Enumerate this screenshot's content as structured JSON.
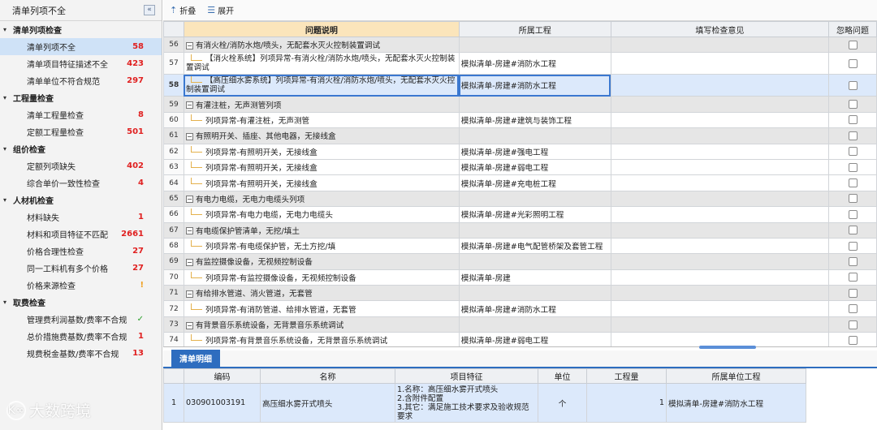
{
  "sidebar": {
    "title": "清单列项不全",
    "collapse_icon": "«",
    "groups": [
      {
        "label": "清单列项检查",
        "items": [
          {
            "label": "清单列项不全",
            "count": "58",
            "status": "error"
          },
          {
            "label": "清单项目特征描述不全",
            "count": "423",
            "status": "error"
          },
          {
            "label": "清单单位不符合规范",
            "count": "297",
            "status": "error"
          }
        ]
      },
      {
        "label": "工程量检查",
        "items": [
          {
            "label": "清单工程量检查",
            "count": "8",
            "status": "error"
          },
          {
            "label": "定额工程量检查",
            "count": "501",
            "status": "error"
          }
        ]
      },
      {
        "label": "组价检查",
        "items": [
          {
            "label": "定额列项缺失",
            "count": "402",
            "status": "error"
          },
          {
            "label": "综合单价一致性检查",
            "count": "4",
            "status": "error"
          }
        ]
      },
      {
        "label": "人材机检查",
        "items": [
          {
            "label": "材料缺失",
            "count": "1",
            "status": "error"
          },
          {
            "label": "材料和项目特征不匹配",
            "count": "2661",
            "status": "error"
          },
          {
            "label": "价格合理性检查",
            "count": "27",
            "status": "error"
          },
          {
            "label": "同一工料机有多个价格",
            "count": "27",
            "status": "error"
          },
          {
            "label": "价格来源检查",
            "count": "!",
            "status": "warn"
          }
        ]
      },
      {
        "label": "取费检查",
        "items": [
          {
            "label": "管理费利润基数/费率不合规",
            "count": "✓",
            "status": "ok"
          },
          {
            "label": "总价措施费基数/费率不合规",
            "count": "1",
            "status": "error"
          },
          {
            "label": "规费税金基数/费率不合规",
            "count": "13",
            "status": "error"
          }
        ]
      }
    ]
  },
  "watermark": {
    "logo": "K∞",
    "text": "大数跨境"
  },
  "toolbar": {
    "collapse_label": "折叠",
    "expand_label": "展开"
  },
  "grid": {
    "headers": [
      "问题说明",
      "所属工程",
      "填写检查意见",
      "忽略问题"
    ],
    "rows": [
      {
        "num": "56",
        "type": "group",
        "desc": "有消火栓/消防水炮/喷头，无配套水灭火控制装置调试",
        "proj": ""
      },
      {
        "num": "57",
        "type": "child",
        "tall": true,
        "desc": "【消火栓系统】列项异常-有消火栓/消防水炮/喷头，无配套水灭火控制装置调试",
        "proj": "模拟清单-房建#消防水工程"
      },
      {
        "num": "58",
        "type": "child",
        "tall": true,
        "selected": true,
        "desc": "【高压细水雾系统】列项异常-有消火栓/消防水炮/喷头，无配套水灭火控制装置调试",
        "proj": "模拟清单-房建#消防水工程"
      },
      {
        "num": "59",
        "type": "group",
        "desc": "有灌注桩，无声测管列项",
        "proj": ""
      },
      {
        "num": "60",
        "type": "child",
        "desc": "列项异常-有灌注桩，无声测管",
        "proj": "模拟清单-房建#建筑与装饰工程"
      },
      {
        "num": "61",
        "type": "group",
        "desc": "有照明开关、插座、其他电器，无接线盒",
        "proj": ""
      },
      {
        "num": "62",
        "type": "child",
        "desc": "列项异常-有照明开关，无接线盒",
        "proj": "模拟清单-房建#强电工程"
      },
      {
        "num": "63",
        "type": "child",
        "desc": "列项异常-有照明开关，无接线盒",
        "proj": "模拟清单-房建#弱电工程"
      },
      {
        "num": "64",
        "type": "child",
        "desc": "列项异常-有照明开关，无接线盒",
        "proj": "模拟清单-房建#充电桩工程"
      },
      {
        "num": "65",
        "type": "group",
        "desc": "有电力电缆，无电力电缆头列项",
        "proj": ""
      },
      {
        "num": "66",
        "type": "child",
        "desc": "列项异常-有电力电缆，无电力电缆头",
        "proj": "模拟清单-房建#光彩照明工程"
      },
      {
        "num": "67",
        "type": "group",
        "desc": "有电缆保护管清单，无挖/填土",
        "proj": ""
      },
      {
        "num": "68",
        "type": "child",
        "desc": "列项异常-有电缆保护管，无土方挖/填",
        "proj": "模拟清单-房建#电气配管桥架及套管工程"
      },
      {
        "num": "69",
        "type": "group",
        "desc": "有监控摄像设备，无视频控制设备",
        "proj": ""
      },
      {
        "num": "70",
        "type": "child",
        "desc": "列项异常-有监控摄像设备，无视频控制设备",
        "proj": "模拟清单-房建"
      },
      {
        "num": "71",
        "type": "group",
        "desc": "有给排水管道、消火管道，无套管",
        "proj": ""
      },
      {
        "num": "72",
        "type": "child",
        "desc": "列项异常-有消防管道、给排水管道，无套管",
        "proj": "模拟清单-房建#消防水工程"
      },
      {
        "num": "73",
        "type": "group",
        "desc": "有背景音乐系统设备，无背景音乐系统调试",
        "proj": ""
      },
      {
        "num": "74",
        "type": "child",
        "desc": "列项异常-有背景音乐系统设备，无背景音乐系统调试",
        "proj": "模拟清单-房建#弱电工程"
      }
    ]
  },
  "detail": {
    "tab_label": "清单明细",
    "headers": [
      "编码",
      "名称",
      "项目特征",
      "单位",
      "工程量",
      "所属单位工程"
    ],
    "rows": [
      {
        "num": "1",
        "code": "030901003191",
        "name": "高压细水雾开式喷头",
        "features": "1.名称：高压细水雾开式喷头\n2.含附件配置\n3.其它：满足施工技术要求及验收规范要求",
        "unit": "个",
        "qty": "1",
        "owner": "模拟清单-房建#消防水工程"
      }
    ]
  }
}
